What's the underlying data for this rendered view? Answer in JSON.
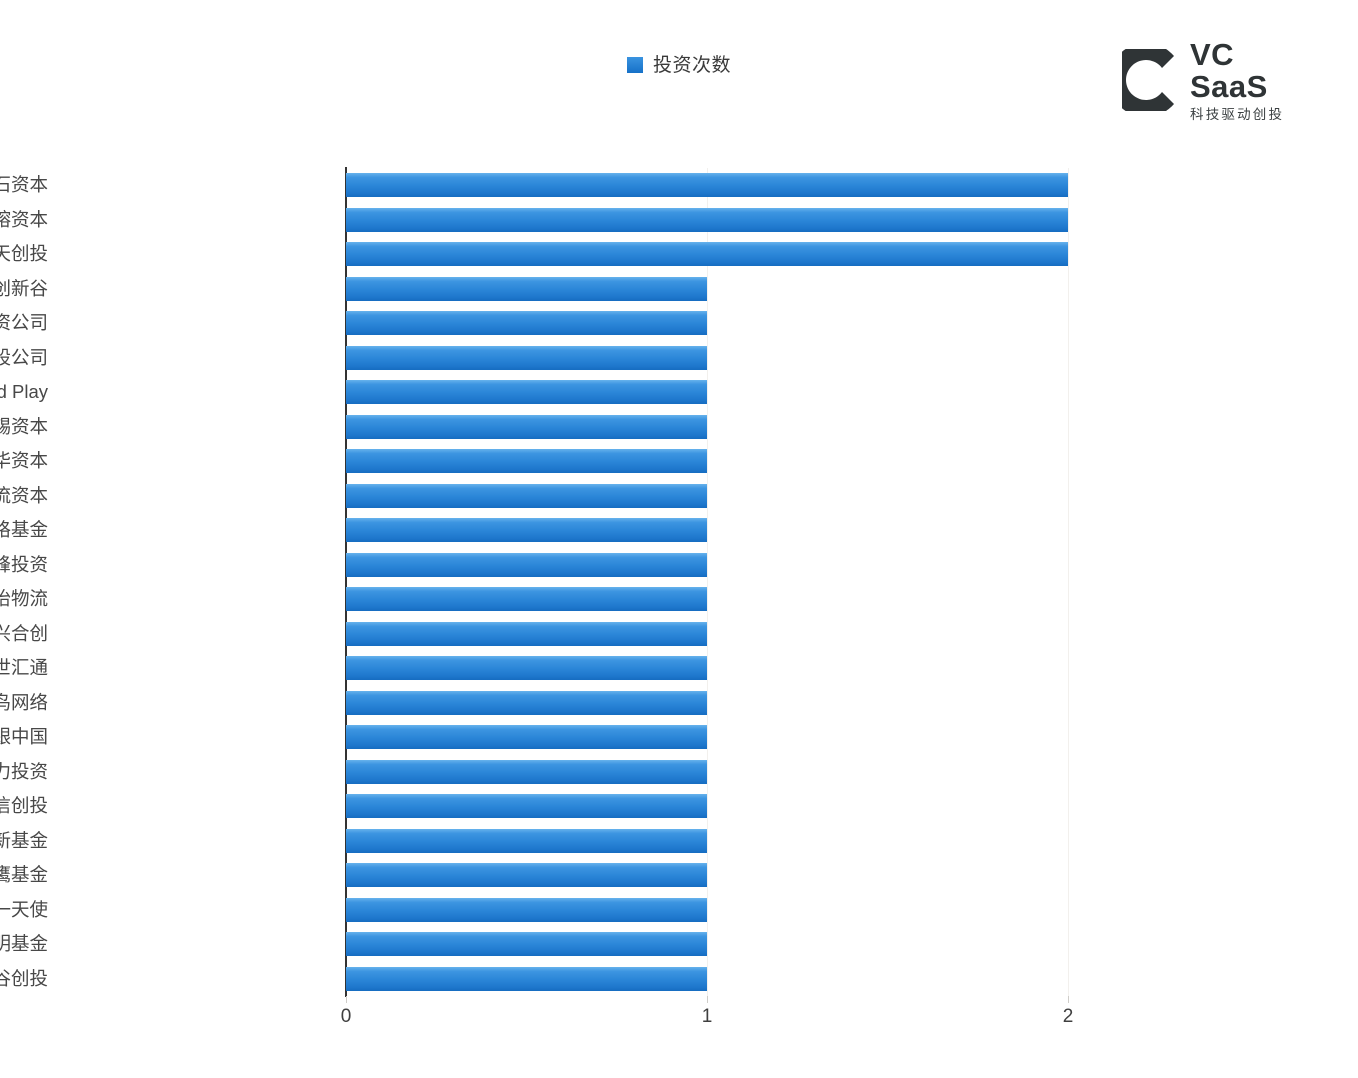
{
  "legend": {
    "label": "投资次数",
    "marker_color": "#1f7fd4",
    "icon": "square-swatch-icon"
  },
  "brand": {
    "name": "VC SaaS",
    "tagline": "科技驱动创投",
    "mark": "c-crescent-logo-icon",
    "color": "#2f3436"
  },
  "chart_data": {
    "type": "bar",
    "orientation": "horizontal",
    "title": "",
    "subtitle": "",
    "xlabel": "",
    "ylabel": "",
    "xlim": [
      0,
      2
    ],
    "xticks": [
      "0",
      "1",
      "2"
    ],
    "grid": true,
    "legend_position": "top-center",
    "series": [
      {
        "name": "投资次数",
        "color": "#1f7fd4",
        "values": [
          2,
          2,
          2,
          1,
          1,
          1,
          1,
          1,
          1,
          1,
          1,
          1,
          1,
          1,
          1,
          1,
          1,
          1,
          1,
          1,
          1,
          1,
          1,
          1
        ]
      }
    ],
    "categories": [
      "火山石资本",
      "高榕资本",
      "信天创投",
      "创新谷",
      "新加坡政府投资公司",
      "马来西亚国库控股公司",
      "Plug and Play",
      "Temasek淡马锡资本",
      "春华资本",
      "清流资本",
      "真格基金",
      "祥峰投资",
      "心怡物流",
      "中兴合创",
      "百世汇通",
      "菜鸟网络",
      "软银中国",
      "合力投资",
      "纽信创投",
      "清华大学创新基金",
      "老鹰基金",
      "易一天使",
      "乾明基金",
      "嘉道谷创投"
    ]
  }
}
